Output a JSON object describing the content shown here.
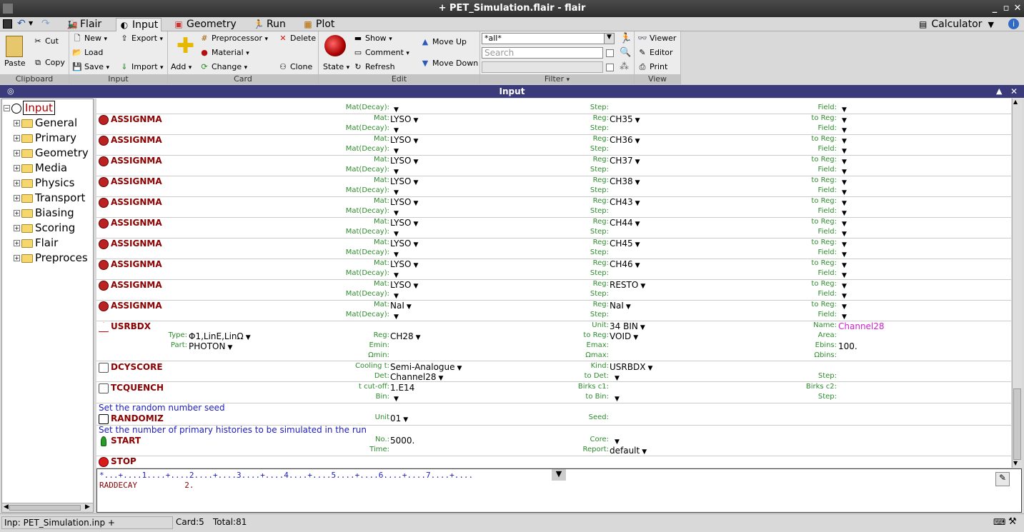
{
  "window": {
    "title": "+ PET_Simulation.flair - flair"
  },
  "tabs": [
    "Flair",
    "Input",
    "Geometry",
    "Run",
    "Plot"
  ],
  "calculator": "Calculator",
  "ribbon": {
    "clipboard": {
      "label": "Clipboard",
      "paste": "Paste",
      "cut": "Cut",
      "copy": "Copy"
    },
    "input": {
      "label": "Input",
      "new": "New",
      "load": "Load",
      "save": "Save",
      "export": "Export",
      "import": "Import"
    },
    "card": {
      "label": "Card",
      "add": "Add",
      "preprocessor": "Preprocessor",
      "material": "Material",
      "change": "Change",
      "delete": "Delete",
      "clone": "Clone"
    },
    "edit": {
      "label": "Edit",
      "state": "State",
      "show": "Show",
      "comment": "Comment",
      "refresh": "Refresh",
      "move_up": "Move Up",
      "move_down": "Move Down"
    },
    "filter": {
      "label": "Filter",
      "value": "*all*",
      "search_placeholder": "Search"
    },
    "view": {
      "label": "View",
      "viewer": "Viewer",
      "editor": "Editor",
      "print": "Print"
    }
  },
  "panel_title": "Input",
  "tree": {
    "root": "Input",
    "items": [
      "General",
      "Primary",
      "Geometry",
      "Media",
      "Physics",
      "Transport",
      "Biasing",
      "Scoring",
      "Flair",
      "Preproces"
    ]
  },
  "assignma": [
    {
      "mat": "LYSO",
      "reg": "CH35"
    },
    {
      "mat": "LYSO",
      "reg": "CH36"
    },
    {
      "mat": "LYSO",
      "reg": "CH37"
    },
    {
      "mat": "LYSO",
      "reg": "CH38"
    },
    {
      "mat": "LYSO",
      "reg": "CH43"
    },
    {
      "mat": "LYSO",
      "reg": "CH44"
    },
    {
      "mat": "LYSO",
      "reg": "CH45"
    },
    {
      "mat": "LYSO",
      "reg": "CH46"
    },
    {
      "mat": "LYSO",
      "reg": "RESTO"
    },
    {
      "mat": "NaI",
      "reg": "NaI"
    }
  ],
  "labels": {
    "assignma": "ASSIGNMA",
    "mat": "Mat:",
    "mat_decay": "Mat(Decay):",
    "reg": "Reg:",
    "step": "Step:",
    "to_reg": "to Reg:",
    "field": "Field:",
    "usrbdx": "USRBDX",
    "type": "Type:",
    "part": "Part:",
    "emin": "Emin:",
    "omin": "Ωmin:",
    "unit": "Unit:",
    "emax": "Emax:",
    "omax": "Ωmax:",
    "name": "Name:",
    "area": "Area:",
    "ebins": "Ebins:",
    "obins": "Ωbins:",
    "dcyscore": "DCYSCORE",
    "cooling": "Cooling t:",
    "det": "Det:",
    "kind": "Kind:",
    "to_det": "to Det:",
    "tcquench": "TCQUENCH",
    "tcutoff": "t cut-off:",
    "bin": "Bin:",
    "birks1": "Birks c1:",
    "to_bin": "to Bin:",
    "birks2": "Birks c2:",
    "randomiz": "RANDOMIZ",
    "unit2": "Unit",
    "seed": "Seed:",
    "start": "START",
    "no": "No.:",
    "time": "Time:",
    "core": "Core:",
    "report": "Report:",
    "stop": "STOP"
  },
  "usrbdx": {
    "type": "Φ1,LinE,LinΩ",
    "part": "PHOTON",
    "reg": "CH28",
    "to_reg": "VOID",
    "unit": "34 BIN",
    "name": "Channel28",
    "ebins": "100."
  },
  "dcyscore": {
    "cooling": "Semi-Analogue",
    "det": "Channel28",
    "kind": "USRBDX"
  },
  "tcquench": {
    "tcutoff": "1.E14"
  },
  "comments": {
    "randomiz": "Set the random number seed",
    "start": "Set the number of primary histories to be simulated in the run"
  },
  "randomiz": {
    "unit": "01"
  },
  "start": {
    "no": "5000.",
    "report": "default"
  },
  "editor": {
    "ruler": "*...+....1....+....2....+....3....+....4....+....5....+....6....+....7....+....",
    "line": "RADDECAY          2."
  },
  "status": {
    "file": "Inp: PET_Simulation.inp +",
    "card": "Card:5",
    "total": "Total:81"
  }
}
